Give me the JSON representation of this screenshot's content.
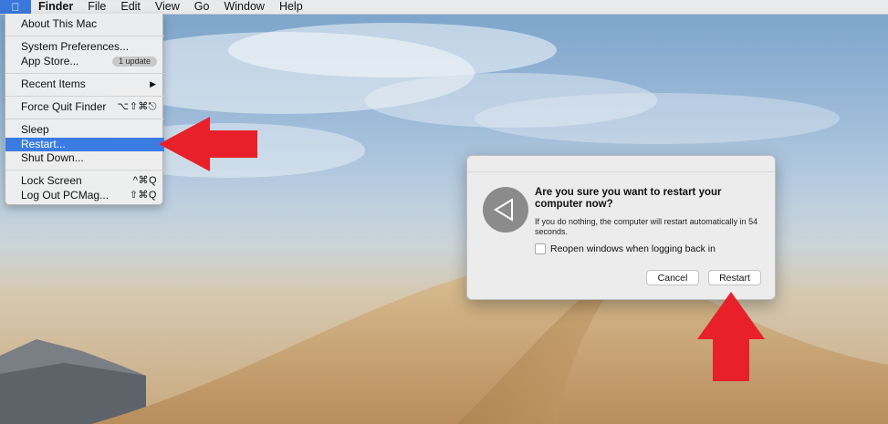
{
  "menubar": {
    "apple_icon": "apple-logo-icon",
    "app_name": "Finder",
    "menus": [
      "File",
      "Edit",
      "View",
      "Go",
      "Window",
      "Help"
    ]
  },
  "apple_menu": {
    "about": "About This Mac",
    "system_prefs": "System Preferences...",
    "app_store": "App Store...",
    "app_store_badge": "1 update",
    "recent_items": "Recent Items",
    "force_quit": "Force Quit Finder",
    "force_quit_shortcut": "⌥⇧⌘⎋",
    "sleep": "Sleep",
    "restart": "Restart...",
    "shut_down": "Shut Down...",
    "lock_screen": "Lock Screen",
    "lock_screen_shortcut": "^⌘Q",
    "log_out": "Log Out PCMag...",
    "log_out_shortcut": "⇧⌘Q"
  },
  "dialog": {
    "heading": "Are you sure you want to restart your computer now?",
    "message": "If you do nothing, the computer will restart automatically in 54 seconds.",
    "checkbox_label": "Reopen windows when logging back in",
    "checkbox_checked": false,
    "cancel_label": "Cancel",
    "restart_label": "Restart"
  },
  "colors": {
    "highlight": "#3b7ce3",
    "arrow_red": "#e8202a"
  }
}
